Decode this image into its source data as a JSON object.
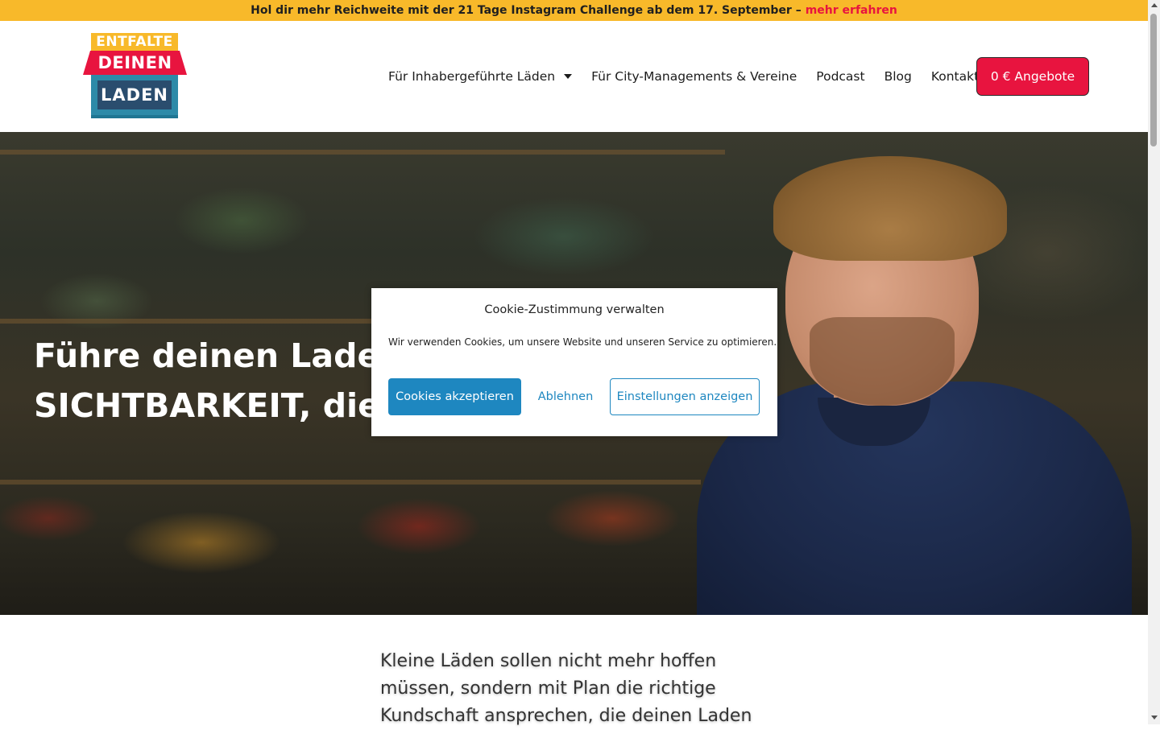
{
  "announcement": {
    "text": "Hol dir mehr Reichweite mit der 21 Tage Instagram Challenge ab dem 17. September –",
    "link": "mehr erfahren"
  },
  "logo": {
    "line1": "ENTFALTE",
    "line2": "DEINEN",
    "line3": "LADEN"
  },
  "nav": {
    "items": [
      {
        "label": "Für Inhabergeführte Läden",
        "has_dropdown": true
      },
      {
        "label": "Für City-Managements & Vereine"
      },
      {
        "label": "Podcast"
      },
      {
        "label": "Blog"
      },
      {
        "label": "Kontakt"
      }
    ],
    "cta": "0 € Angebote"
  },
  "hero": {
    "title": "Führe deinen Laden in die SICHTBARKEIT, die er verdient!"
  },
  "cookie_modal": {
    "title": "Cookie-Zustimmung verwalten",
    "text": "Wir verwenden Cookies, um unsere Website und unseren Service zu optimieren.",
    "accept": "Cookies akzeptieren",
    "decline": "Ablehnen",
    "settings": "Einstellungen anzeigen"
  },
  "intro": {
    "text": "Kleine Läden sollen nicht mehr hoffen müssen, sondern mit Plan die richtige Kundschaft ansprechen, die deinen Laden"
  },
  "colors": {
    "announcement_bg": "#f8b92a",
    "accent": "#e8143f",
    "cookie_blue": "#1e87c0"
  }
}
